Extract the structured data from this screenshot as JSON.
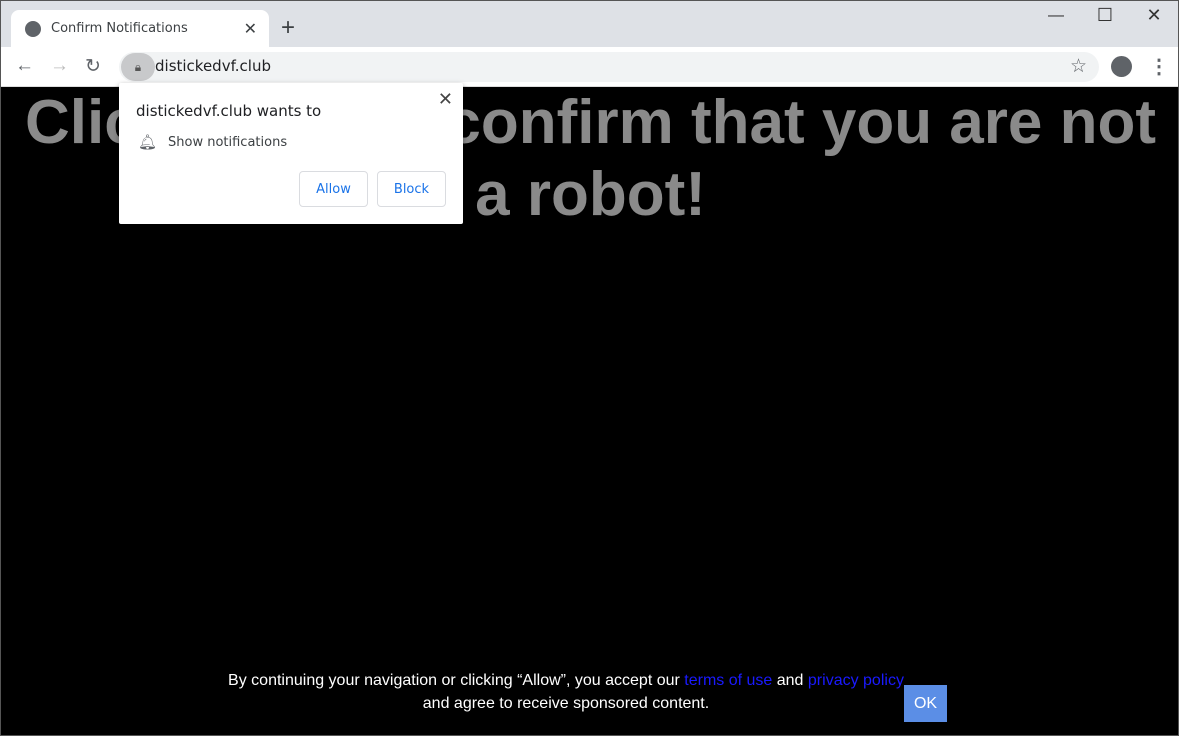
{
  "browser": {
    "tab_title": "Confirm Notifications",
    "url": "distickedvf.club"
  },
  "page": {
    "headline": "Click Allow to confirm that you are not a robot!",
    "footer": {
      "text1": "By continuing your navigation or clicking “Allow”, you accept our ",
      "terms": "terms of use",
      "and": " and ",
      "privacy": "privacy policy",
      "text2": "and agree to receive sponsored content."
    },
    "ok": "OK"
  },
  "popup": {
    "title": "distickedvf.club wants to",
    "permission": "Show notifications",
    "allow": "Allow",
    "block": "Block"
  }
}
